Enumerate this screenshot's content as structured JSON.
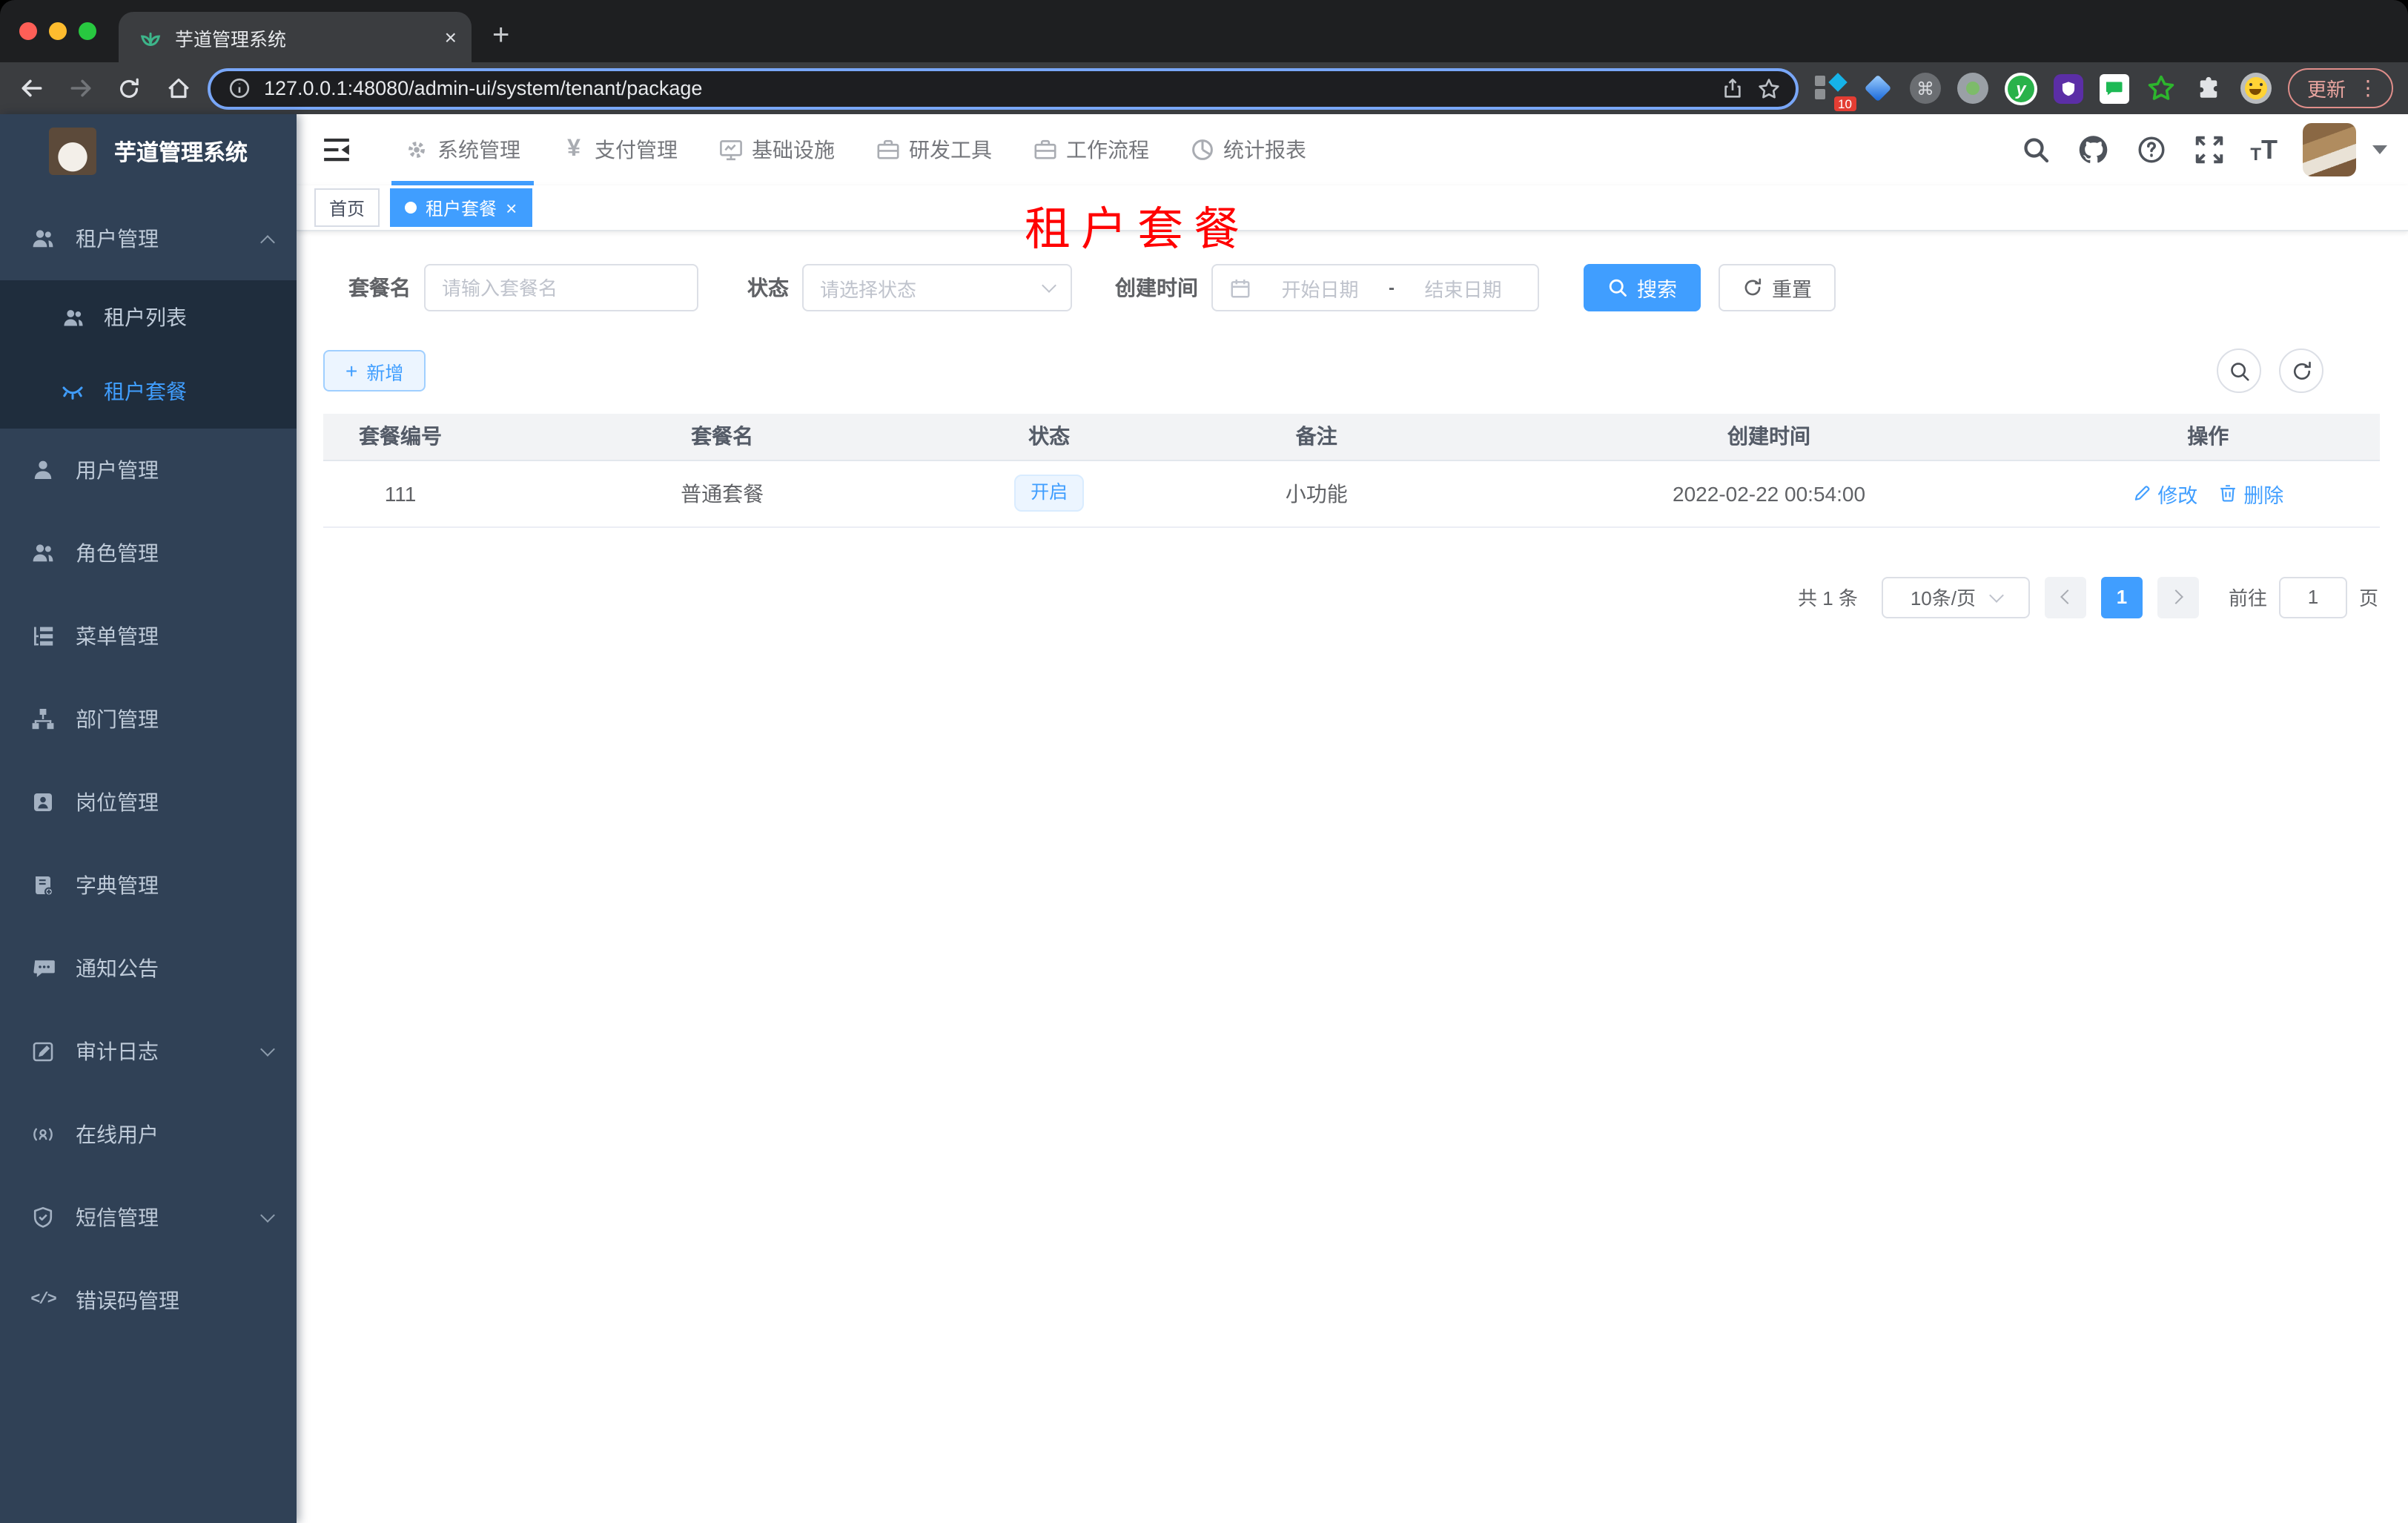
{
  "browser": {
    "tab": {
      "title": "芋道管理系统"
    },
    "toolbar": {
      "url": "127.0.0.1:48080/admin-ui/system/tenant/package",
      "update_label": "更新",
      "extension_badge": "10"
    }
  },
  "icons": {
    "close": "×",
    "plus": "+",
    "dots_vertical": "⋮",
    "command": "⌘",
    "yen": "¥",
    "code": "</>",
    "ext_y": "y",
    "font_size_small": "T",
    "font_size_large": "T",
    "help_mark": "?"
  },
  "app": {
    "logo_title": "芋道管理系统",
    "nav": [
      {
        "label": "系统管理",
        "icon": "gear",
        "active": true
      },
      {
        "label": "支付管理",
        "icon": "yen"
      },
      {
        "label": "基础设施",
        "icon": "monitor"
      },
      {
        "label": "研发工具",
        "icon": "briefcase"
      },
      {
        "label": "工作流程",
        "icon": "briefcase"
      },
      {
        "label": "统计报表",
        "icon": "pie-chart"
      }
    ],
    "sidebar": {
      "items": [
        {
          "label": "租户管理",
          "icon": "peoples",
          "expanded": true
        },
        {
          "label": "租户列表",
          "icon": "peoples",
          "child": true
        },
        {
          "label": "租户套餐",
          "icon": "eye-closed",
          "child": true,
          "active": true
        },
        {
          "label": "用户管理",
          "icon": "user"
        },
        {
          "label": "角色管理",
          "icon": "peoples"
        },
        {
          "label": "菜单管理",
          "icon": "tree-table"
        },
        {
          "label": "部门管理",
          "icon": "org-tree"
        },
        {
          "label": "岗位管理",
          "icon": "post-badge"
        },
        {
          "label": "字典管理",
          "icon": "dict-book"
        },
        {
          "label": "通知公告",
          "icon": "message"
        },
        {
          "label": "审计日志",
          "icon": "log-edit",
          "collapsible": true
        },
        {
          "label": "在线用户",
          "icon": "online"
        },
        {
          "label": "短信管理",
          "icon": "shield",
          "collapsible": true
        },
        {
          "label": "错误码管理",
          "icon": "code"
        }
      ]
    },
    "tags": {
      "home": "首页",
      "active": "租户套餐"
    },
    "watermark": "租户套餐",
    "filters": {
      "name_label": "套餐名",
      "name_placeholder": "请输入套餐名",
      "status_label": "状态",
      "status_placeholder": "请选择状态",
      "date_label": "创建时间",
      "date_start_placeholder": "开始日期",
      "date_separator": "-",
      "date_end_placeholder": "结束日期",
      "search_label": "搜索",
      "reset_label": "重置"
    },
    "toolbar": {
      "add_label": "新增"
    },
    "table": {
      "columns": [
        "套餐编号",
        "套餐名",
        "状态",
        "备注",
        "创建时间",
        "操作"
      ],
      "rows": [
        {
          "id": "111",
          "name": "普通套餐",
          "status": "开启",
          "remark": "小功能",
          "created": "2022-02-22 00:54:00",
          "edit": "修改",
          "delete": "删除"
        }
      ]
    },
    "pagination": {
      "total": "共 1 条",
      "page_size": "10条/页",
      "page": "1",
      "goto_label": "前往",
      "goto_value": "1",
      "unit": "页"
    }
  }
}
